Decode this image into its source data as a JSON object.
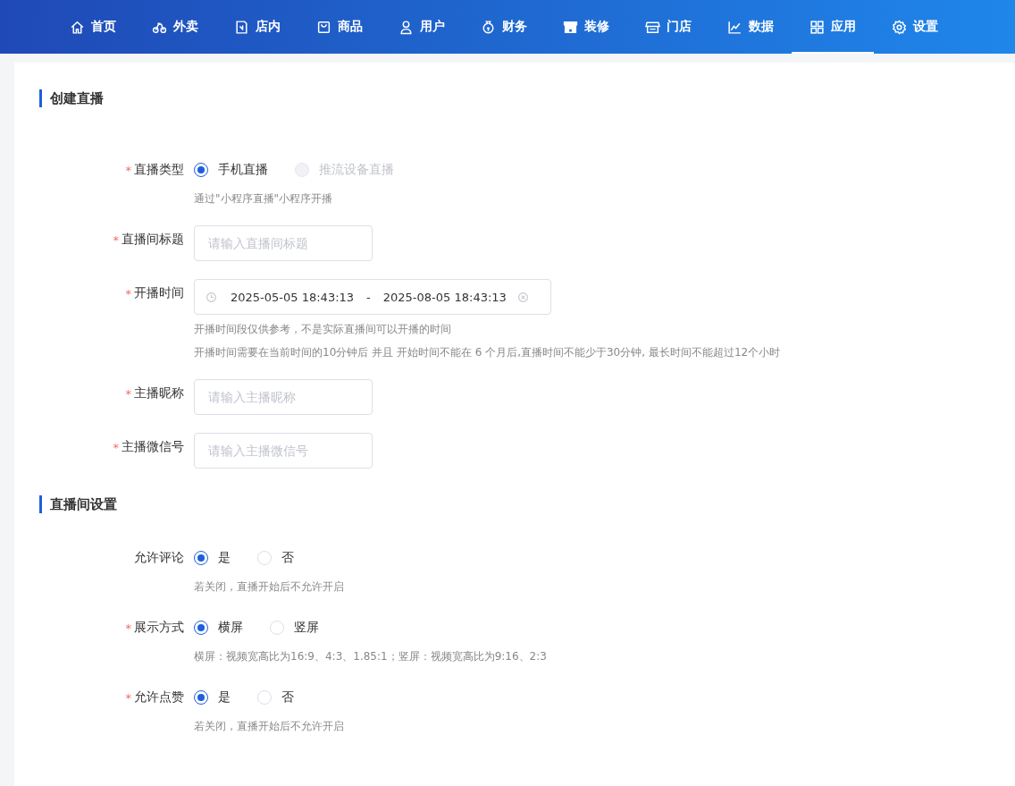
{
  "nav": {
    "items": [
      {
        "label": "首页",
        "selected": false
      },
      {
        "label": "外卖",
        "selected": false
      },
      {
        "label": "店内",
        "selected": false
      },
      {
        "label": "商品",
        "selected": false
      },
      {
        "label": "用户",
        "selected": false
      },
      {
        "label": "财务",
        "selected": false
      },
      {
        "label": "装修",
        "selected": false
      },
      {
        "label": "门店",
        "selected": false
      },
      {
        "label": "数据",
        "selected": false
      },
      {
        "label": "应用",
        "selected": true
      },
      {
        "label": "设置",
        "selected": false
      }
    ]
  },
  "sections": [
    {
      "title": "创建直播",
      "fields": [
        {
          "kind": "radio",
          "required_mark": "*",
          "label": "直播类型",
          "options": [
            {
              "label": "手机直播",
              "selected": true,
              "disabled": false
            },
            {
              "label": "推流设备直播",
              "selected": false,
              "disabled": true
            }
          ],
          "hints": [
            "通过\"小程序直播\"小程序开播"
          ]
        },
        {
          "kind": "input",
          "required_mark": "*",
          "label": "直播间标题",
          "placeholder": "请输入直播间标题"
        },
        {
          "kind": "daterange",
          "required_mark": "*",
          "label": "开播时间",
          "start": "2025-05-05 18:43:13",
          "separator": "-",
          "end": "2025-08-05 18:43:13",
          "hints": [
            "开播时间段仅供参考，不是实际直播间可以开播的时间",
            "开播时间需要在当前时间的10分钟后 并且 开始时间不能在 6 个月后,直播时间不能少于30分钟, 最长时间不能超过12个小时"
          ]
        },
        {
          "kind": "input",
          "required_mark": "*",
          "label": "主播昵称",
          "placeholder": "请输入主播昵称"
        },
        {
          "kind": "input",
          "required_mark": "*",
          "label": "主播微信号",
          "placeholder": "请输入主播微信号"
        }
      ]
    },
    {
      "title": "直播间设置",
      "fields": [
        {
          "kind": "radio",
          "label": "允许评论",
          "options": [
            {
              "label": "是",
              "selected": true,
              "disabled": false
            },
            {
              "label": "否",
              "selected": false,
              "disabled": false
            }
          ],
          "hints": [
            "若关闭，直播开始后不允许开启"
          ]
        },
        {
          "kind": "radio",
          "required_mark": "*",
          "label": "展示方式",
          "options": [
            {
              "label": "横屏",
              "selected": true,
              "disabled": false
            },
            {
              "label": "竖屏",
              "selected": false,
              "disabled": false
            }
          ],
          "hints": [
            "横屏：视频宽高比为16:9、4:3、1.85:1；竖屏：视频宽高比为9:16、2:3"
          ]
        },
        {
          "kind": "radio",
          "required_mark": "*",
          "label": "允许点赞",
          "options": [
            {
              "label": "是",
              "selected": true,
              "disabled": false
            },
            {
              "label": "否",
              "selected": false,
              "disabled": false
            }
          ],
          "hints": [
            "若关闭，直播开始后不允许开启"
          ]
        }
      ]
    }
  ]
}
